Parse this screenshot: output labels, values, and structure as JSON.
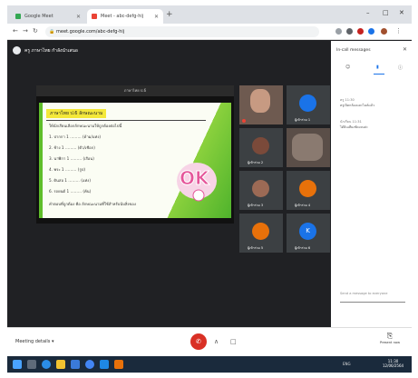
{
  "browser": {
    "tabs": [
      {
        "label": "Google Meet"
      },
      {
        "label": "Meet - abc-defg-hij"
      }
    ],
    "new_tab_glyph": "+",
    "url": "meet.google.com/abc-defg-hij",
    "window_controls": [
      "–",
      "□",
      "✕"
    ]
  },
  "meet": {
    "presenter_label": "ครู ภาษาไทย กำลังนำเสนอ",
    "presentation_bar_text": "ภาษาไทย ป.6",
    "slide": {
      "heading": "ภาษาไทย ป.6 ลักษณะนาม",
      "lines": [
        "ให้นักเรียนเลือกลักษณะนามให้ถูกต้องต่อไปนี้",
        "1. ปากกา 1 ……… (ด้าม/แท่ง)",
        "2. ช้าง 1 ……… (ตัว/เชือก)",
        "3. นาฬิกา 1 ……… (เรือน)",
        "4. พระ 1 ……… (รูป)",
        "5. ดินสอ 1 ……… (แท่ง)",
        "6. รถยนต์ 1 ……… (คัน)",
        "คำตอบที่ถูกต้อง คือ ลักษณะนามที่ใช้สำหรับนับสิ่งของ"
      ],
      "art_text": "OK"
    },
    "participants": [
      {
        "name": "",
        "avatar_color": "#a77b6a",
        "is_video": true
      },
      {
        "name": "ผู้เข้าร่วม 1",
        "avatar_color": "#1a73e8",
        "is_video": false
      },
      {
        "name": "ผู้เข้าร่วม 2",
        "avatar_color": "#7b4a3a",
        "is_video": false
      },
      {
        "name": "",
        "avatar_color": "#8a7a70",
        "is_video": true
      },
      {
        "name": "ผู้เข้าร่วม 3",
        "avatar_color": "#9c6a55",
        "is_video": false
      },
      {
        "name": "ผู้เข้าร่วม 4",
        "avatar_color": "#e8710a",
        "is_video": false
      },
      {
        "name": "ผู้เข้าร่วม 5",
        "avatar_color": "#e8710a",
        "is_video": false
      },
      {
        "name": "ผู้เข้าร่วม 6",
        "avatar_color": "#1a73e8",
        "is_video": false
      }
    ],
    "participant_avatar_letters": [
      "",
      "",
      "",
      "",
      "",
      "",
      "",
      "K"
    ]
  },
  "panel": {
    "title": "In-call messages",
    "close_glyph": "✕",
    "tabs": [
      "☺",
      "▮",
      "ⓘ"
    ],
    "messages": [
      {
        "sender": "ครู 11:30",
        "text": "ครูเปิดกล้องและไมค์แล้ว"
      },
      {
        "sender": "นักเรียน 11:31",
        "text": "ได้ยินเสียงชัดเจนค่ะ"
      }
    ],
    "input_placeholder": "Send a message to everyone"
  },
  "controls": {
    "meeting_details_label": "Meeting details ▾",
    "end_call_glyph": "✆",
    "mic_glyph": "∧",
    "cam_glyph": "□",
    "present_label": "Present now",
    "present_glyph": "⎘"
  },
  "taskbar": {
    "tray_text": "ENG",
    "clock_time": "11:30",
    "clock_date": "12/06/2564"
  },
  "colors": {
    "meet_bg": "#202124",
    "end_call": "#d93025",
    "accent": "#1a73e8",
    "slide_green": "#5fbe2b",
    "slide_yellow": "#f4e83a"
  }
}
